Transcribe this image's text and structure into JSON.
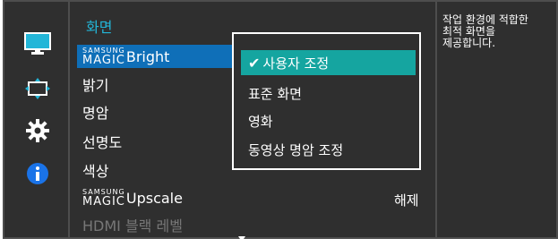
{
  "colors": {
    "accent": "#23b6d8",
    "selected_item": "#0f6fb8",
    "selected_option": "#15a5a0",
    "panel": "#2f2f2f"
  },
  "left_icons": [
    "monitor-icon",
    "resize-arrows-icon",
    "gear-icon",
    "info-icon"
  ],
  "menu": {
    "title": "화면",
    "items": [
      {
        "magic_small": "SAMSUNG",
        "magic_big": "MAGIC",
        "label": "Bright"
      },
      {
        "label": "밝기"
      },
      {
        "label": "명암"
      },
      {
        "label": "선명도"
      },
      {
        "label": "색상"
      },
      {
        "magic_small": "SAMSUNG",
        "magic_big": "MAGIC",
        "label": "Upscale",
        "value": "해제"
      },
      {
        "label": "HDMI 블랙 레벨"
      }
    ]
  },
  "popup": {
    "options": [
      "사용자 조정",
      "표준 화면",
      "영화",
      "동영상 명암 조정"
    ],
    "selected": "사용자 조정"
  },
  "description": "작업 환경에 적합한\n최적 화면을\n제공합니다."
}
